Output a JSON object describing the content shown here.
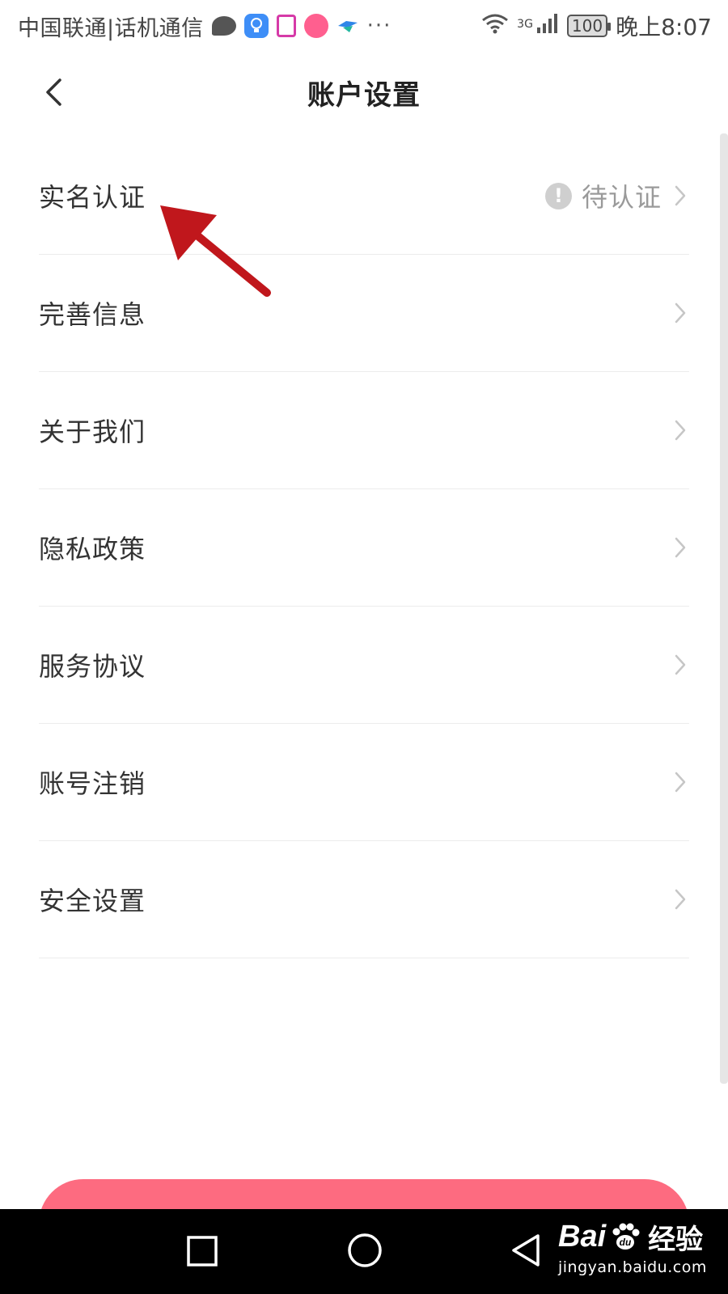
{
  "status_bar": {
    "carrier": "中国联通|话机通信",
    "more": "···",
    "network": "3G",
    "battery": "100",
    "time": "晚上8:07"
  },
  "header": {
    "title": "账户设置"
  },
  "settings": {
    "items": [
      {
        "label": "实名认证",
        "status": "待认证"
      },
      {
        "label": "完善信息"
      },
      {
        "label": "关于我们"
      },
      {
        "label": "隐私政策"
      },
      {
        "label": "服务协议"
      },
      {
        "label": "账号注销"
      },
      {
        "label": "安全设置"
      }
    ]
  },
  "colors": {
    "accent_button": "#fd6b80",
    "annotation_arrow": "#c0171c",
    "status_gray": "#9a9a9a"
  },
  "watermark": {
    "brand": "Bai",
    "brand_tail": "du",
    "product": "经验",
    "url": "jingyan.baidu.com"
  }
}
